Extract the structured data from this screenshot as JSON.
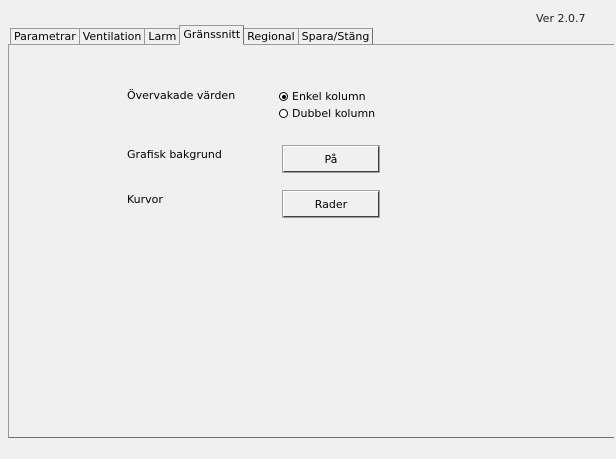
{
  "header": {
    "version": "Ver 2.0.7"
  },
  "tabs": [
    {
      "label": "Parametrar",
      "active": false
    },
    {
      "label": "Ventilation",
      "active": false
    },
    {
      "label": "Larm",
      "active": false
    },
    {
      "label": "Gränssnitt",
      "active": true
    },
    {
      "label": "Regional",
      "active": false
    },
    {
      "label": "Spara/Stäng",
      "active": false
    }
  ],
  "settings": {
    "monitored_values": {
      "label": "Övervakade värden",
      "options": [
        {
          "label": "Enkel kolumn",
          "selected": true
        },
        {
          "label": "Dubbel kolumn",
          "selected": false
        }
      ]
    },
    "graphic_background": {
      "label": "Grafisk bakgrund",
      "button_label": "På"
    },
    "curves": {
      "label": "Kurvor",
      "button_label": "Rader"
    }
  }
}
